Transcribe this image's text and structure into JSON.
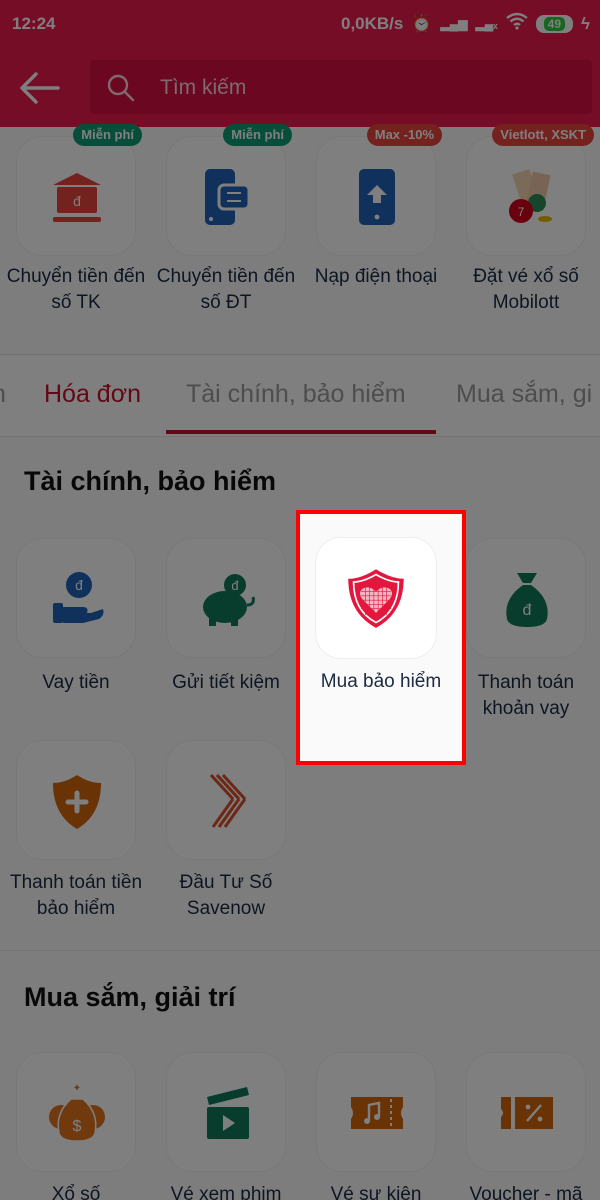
{
  "status_bar": {
    "time": "12:24",
    "network_speed": "0,0KB/s",
    "battery": "49"
  },
  "header": {
    "search_placeholder": "Tìm kiếm"
  },
  "promo_services": [
    {
      "label": "Chuyển tiền đến số TK",
      "badge": "Miễn phí",
      "badge_color": "#0f9d75",
      "icon": "bank-transfer-icon"
    },
    {
      "label": "Chuyển tiền đến số ĐT",
      "badge": "Miễn phí",
      "badge_color": "#0f9d75",
      "icon": "phone-transfer-icon"
    },
    {
      "label": "Nạp điện thoại",
      "badge": "Max -10%",
      "badge_color": "#e8453c",
      "icon": "phone-topup-icon"
    },
    {
      "label": "Đặt vé xổ số Mobilott",
      "badge": "Vietlott, XSKT",
      "badge_color": "#e8453c",
      "icon": "lottery-icon"
    }
  ],
  "tabs": [
    {
      "label": "n"
    },
    {
      "label": "Hóa đơn"
    },
    {
      "label": "Tài chính, bảo hiểm"
    },
    {
      "label": "Mua sắm, gi"
    }
  ],
  "sections": [
    {
      "title": "Tài chính, bảo hiểm",
      "items": [
        {
          "label": "Vay tiền",
          "icon": "loan-hand-coin-icon"
        },
        {
          "label": "Gửi tiết kiệm",
          "icon": "piggy-bank-icon"
        },
        {
          "label": "Mua bảo hiểm",
          "icon": "insurance-shield-heart-icon"
        },
        {
          "label": "Thanh toán khoản vay",
          "icon": "money-bag-icon"
        },
        {
          "label": "Thanh toán tiền bảo hiểm",
          "icon": "shield-plus-icon"
        },
        {
          "label": "Đầu Tư Số Savenow",
          "icon": "savenow-chevron-icon"
        }
      ]
    },
    {
      "title": "Mua sắm, giải trí",
      "items": [
        {
          "label": "Xổ số",
          "icon": "money-bags-icon"
        },
        {
          "label": "Vé xem phim",
          "icon": "clapperboard-icon"
        },
        {
          "label": "Vé sự kiện",
          "icon": "music-ticket-icon"
        },
        {
          "label": "Voucher - mã",
          "icon": "voucher-icon"
        }
      ]
    }
  ],
  "colors": {
    "brand": "#eb1b4f",
    "tab_active": "#c8102e",
    "highlight_border": "#ff0000"
  }
}
